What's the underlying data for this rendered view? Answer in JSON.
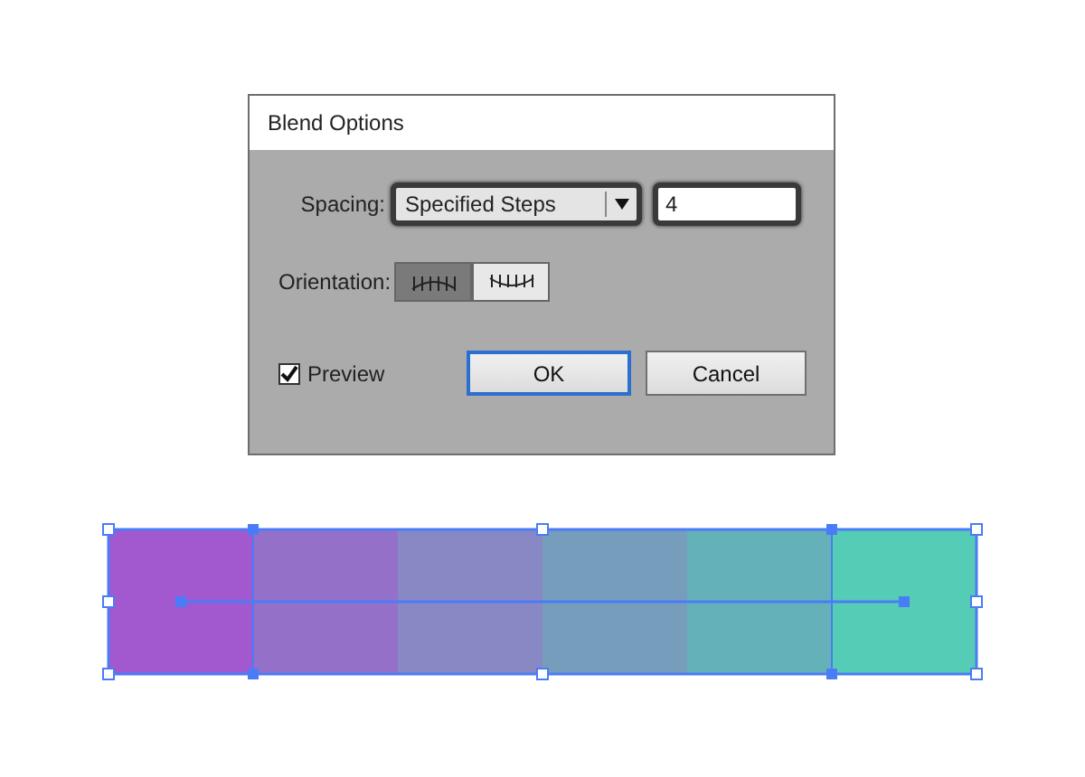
{
  "dialog": {
    "title": "Blend Options",
    "spacing": {
      "label": "Spacing:",
      "value": "Specified Steps",
      "steps": "4"
    },
    "orientation": {
      "label": "Orientation:",
      "options": [
        {
          "kind": "page",
          "selected": true
        },
        {
          "kind": "path",
          "selected": false
        }
      ]
    },
    "preview": {
      "label": "Preview",
      "checked": true
    },
    "buttons": [
      {
        "label": "OK",
        "default": true
      },
      {
        "label": "Cancel",
        "default": false
      }
    ]
  },
  "blend": {
    "swatches": [
      {
        "color": "#a259cf"
      },
      {
        "color": "#9570c9"
      },
      {
        "color": "#8788c4"
      },
      {
        "color": "#779dbd"
      },
      {
        "color": "#64b1b9"
      },
      {
        "color": "#55ccb5"
      }
    ]
  }
}
